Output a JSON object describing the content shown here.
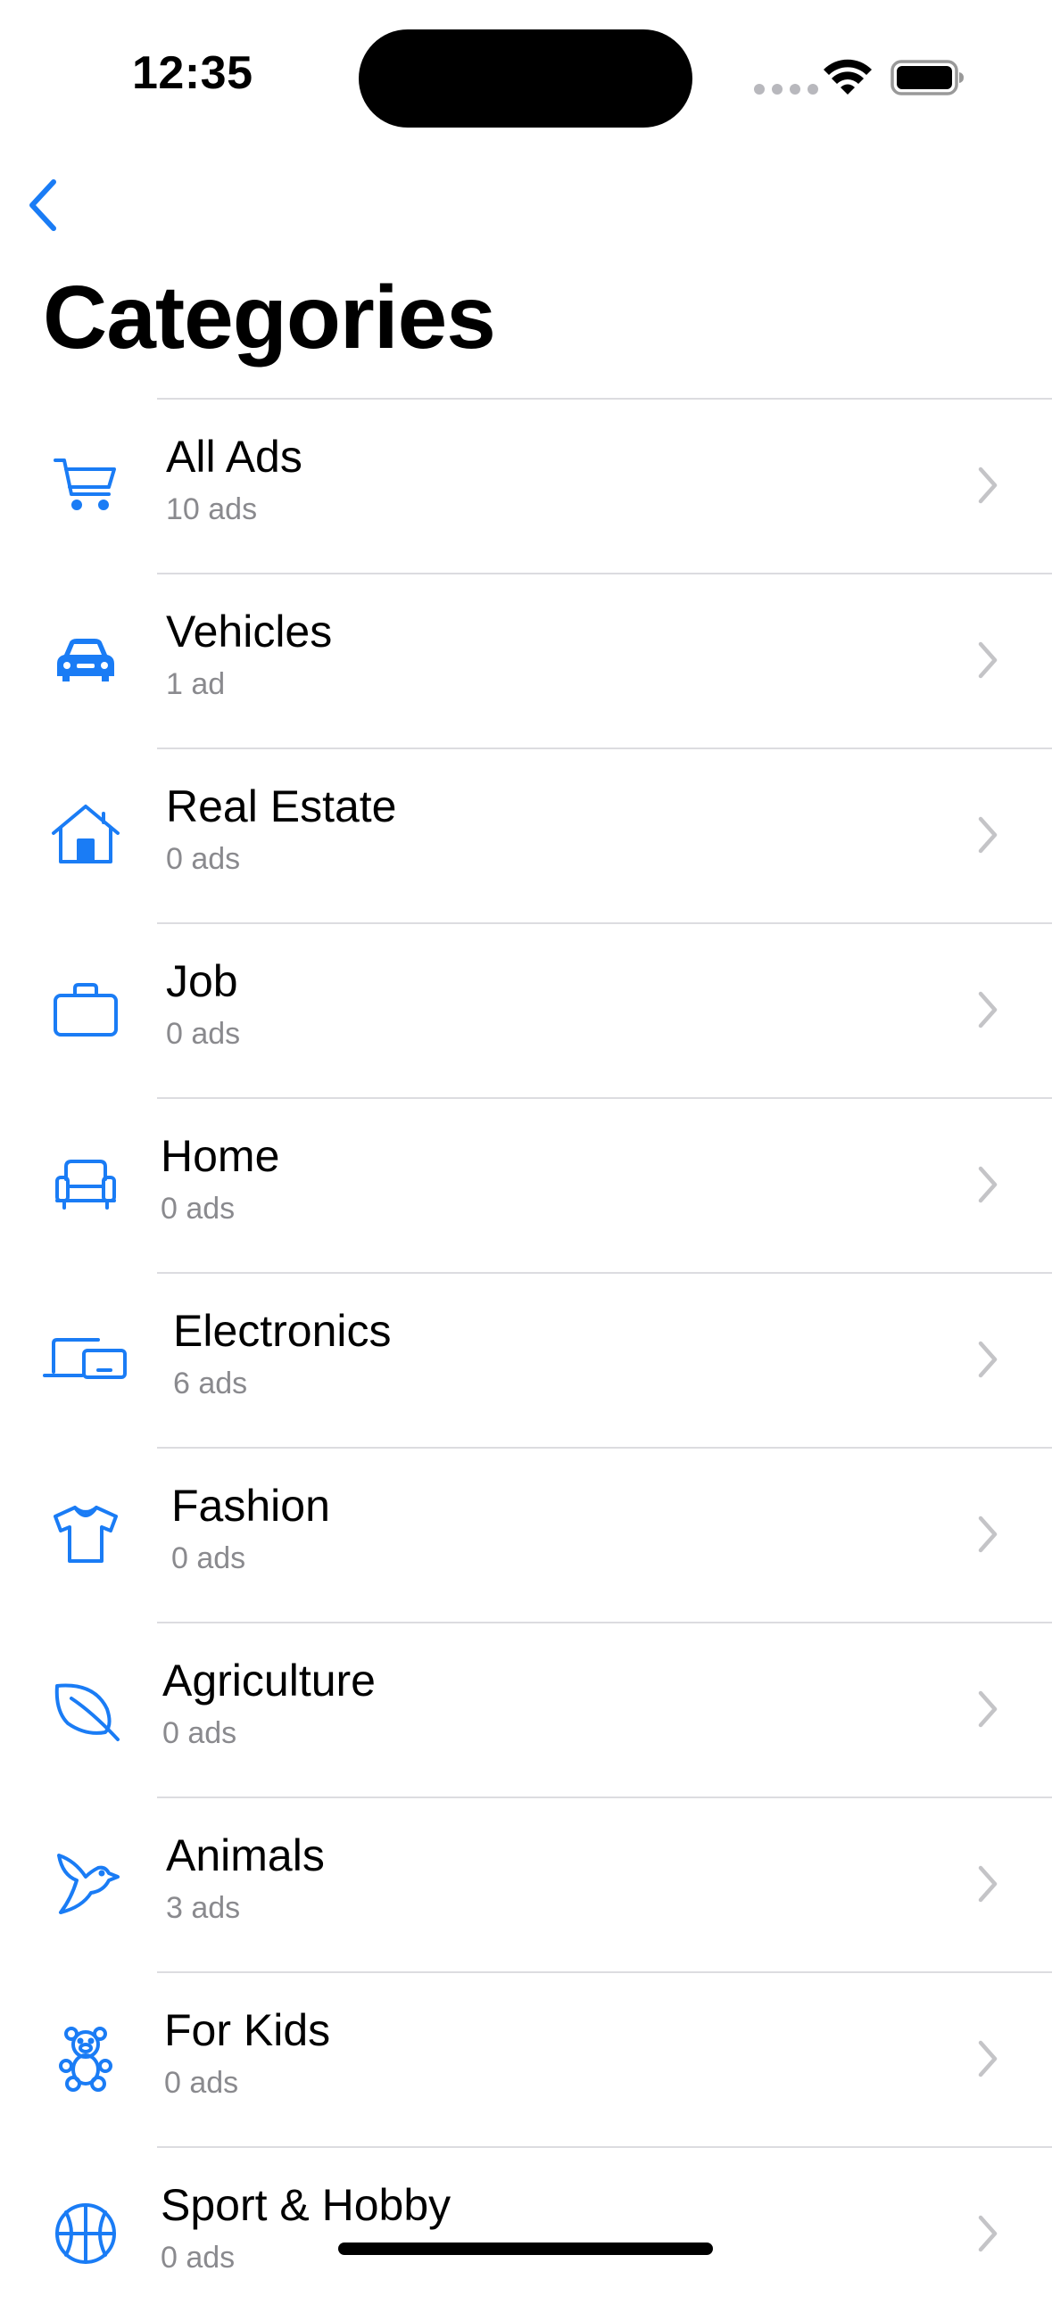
{
  "status_bar": {
    "time": "12:35"
  },
  "nav": {
    "back_icon": "chevron-left-icon",
    "title": "Categories"
  },
  "colors": {
    "accent": "#1a7cf5",
    "secondary_text": "#8a8a8e",
    "separator": "#dcdce0",
    "chevron": "#c4c4c7"
  },
  "categories": [
    {
      "label": "All Ads",
      "count": "10 ads",
      "icon": "cart-icon"
    },
    {
      "label": "Vehicles",
      "count": "1 ad",
      "icon": "car-icon"
    },
    {
      "label": "Real Estate",
      "count": "0 ads",
      "icon": "house-icon"
    },
    {
      "label": "Job",
      "count": "0 ads",
      "icon": "briefcase-icon"
    },
    {
      "label": "Home",
      "count": "0 ads",
      "icon": "armchair-icon"
    },
    {
      "label": "Electronics",
      "count": "6 ads",
      "icon": "devices-icon"
    },
    {
      "label": "Fashion",
      "count": "0 ads",
      "icon": "tshirt-icon"
    },
    {
      "label": "Agriculture",
      "count": "0 ads",
      "icon": "leaf-icon"
    },
    {
      "label": "Animals",
      "count": "3 ads",
      "icon": "bird-icon"
    },
    {
      "label": "For Kids",
      "count": "0 ads",
      "icon": "teddy-bear-icon"
    },
    {
      "label": "Sport & Hobby",
      "count": "0 ads",
      "icon": "basketball-icon"
    }
  ]
}
